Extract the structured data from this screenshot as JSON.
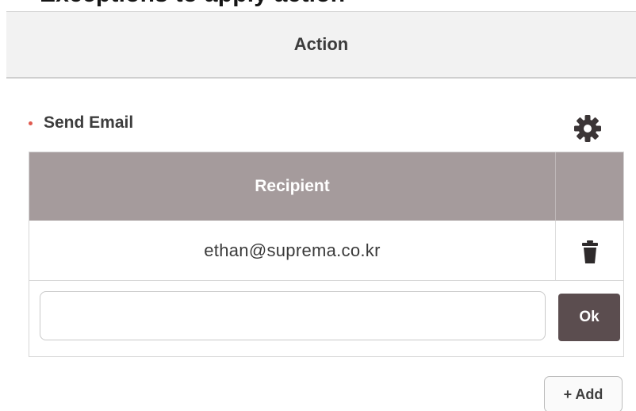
{
  "page": {
    "cropped_heading": "Exceptions to apply action"
  },
  "action_panel": {
    "header_label": "Action",
    "section_label": "Send Email",
    "settings_icon": "gear-icon",
    "table": {
      "column_header": "Recipient",
      "rows": [
        {
          "email": "ethan@suprema.co.kr",
          "delete_icon": "trash-icon"
        }
      ],
      "input_value": "",
      "ok_label": "Ok"
    },
    "add_label": "+ Add"
  },
  "colors": {
    "header_bg": "#f2f2f2",
    "table_header_bg": "#a59b9c",
    "ok_button_bg": "#5b4d4f",
    "bullet": "#e05a4f"
  }
}
